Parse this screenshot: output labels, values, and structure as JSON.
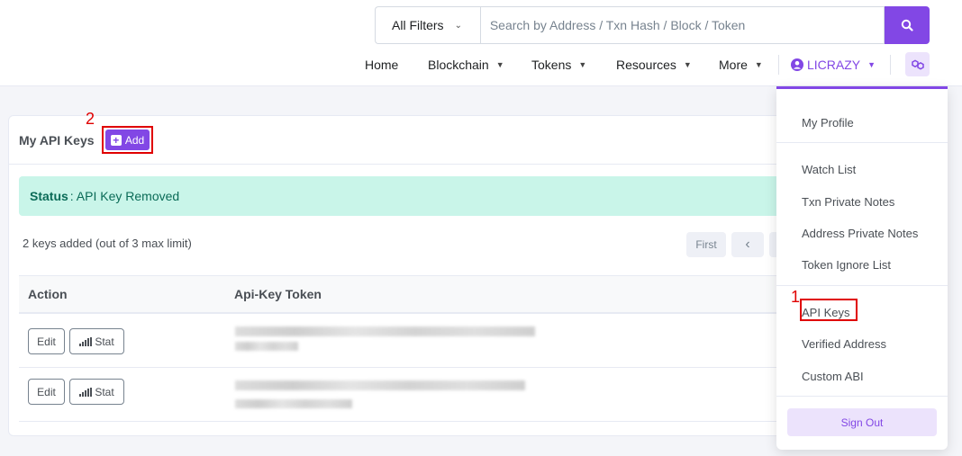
{
  "header": {
    "filter_label": "All Filters",
    "search_placeholder": "Search by Address / Txn Hash / Block / Token",
    "nav": {
      "home": "Home",
      "blockchain": "Blockchain",
      "tokens": "Tokens",
      "resources": "Resources",
      "more": "More",
      "user": "LICRAZY"
    }
  },
  "card": {
    "title": "My API Keys",
    "add_label": "Add",
    "annotation_add": "2",
    "status_label": "Status",
    "status_text": ": API Key Removed",
    "keys_count": "2 keys added (out of 3 max limit)",
    "pager_first": "First",
    "pager_prev": "‹",
    "columns": {
      "action": "Action",
      "token": "Api-Key Token"
    },
    "rows": [
      {
        "edit": "Edit",
        "stat": "Stat"
      },
      {
        "edit": "Edit",
        "stat": "Stat"
      }
    ]
  },
  "dropdown": {
    "annotation_apikeys": "1",
    "items": {
      "my_profile": "My Profile",
      "watch_list": "Watch List",
      "txn_notes": "Txn Private Notes",
      "address_notes": "Address Private Notes",
      "token_ignore": "Token Ignore List",
      "api_keys": "API Keys",
      "verified_address": "Verified Address",
      "custom_abi": "Custom ABI"
    },
    "sign_out": "Sign Out"
  },
  "colors": {
    "accent": "#8247e5",
    "status_bg": "#c9f5e9",
    "annotation": "#e00000"
  }
}
